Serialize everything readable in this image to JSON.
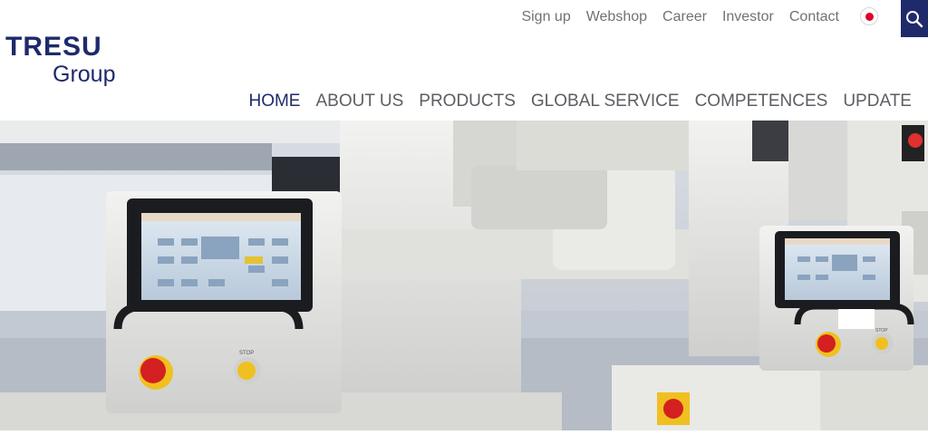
{
  "logo": {
    "line1": "TRESU",
    "line2": "Group",
    "brand_color": "#1f2a6b"
  },
  "top_nav": {
    "items": [
      {
        "label": "Sign up"
      },
      {
        "label": "Webshop"
      },
      {
        "label": "Career"
      },
      {
        "label": "Investor"
      },
      {
        "label": "Contact"
      }
    ],
    "language_icon": "japan-flag-icon",
    "search_icon": "search-icon"
  },
  "main_nav": {
    "items": [
      {
        "label": "HOME",
        "active": true
      },
      {
        "label": "ABOUT US"
      },
      {
        "label": "PRODUCTS"
      },
      {
        "label": "GLOBAL SERVICE"
      },
      {
        "label": "COMPETENCES"
      },
      {
        "label": "UPDATE"
      }
    ]
  },
  "hero": {
    "icon": "printing-machine-image",
    "control_button_labels": [
      "STOP",
      "STOP"
    ]
  },
  "colors": {
    "accent": "#1f2a6b",
    "nav_text": "#5b5e63",
    "topnav_text": "#6f7277"
  }
}
